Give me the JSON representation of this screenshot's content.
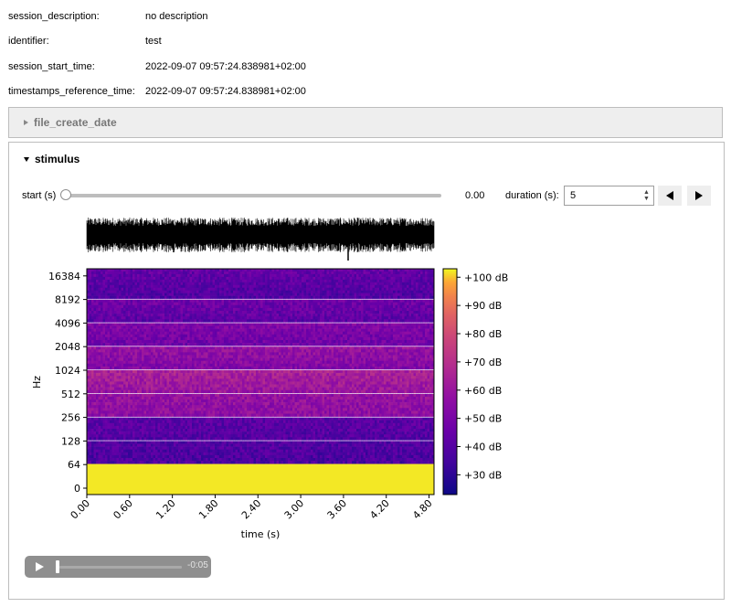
{
  "metadata": {
    "rows": [
      {
        "key": "session_description:",
        "value": "no description"
      },
      {
        "key": "identifier:",
        "value": "test"
      },
      {
        "key": "session_start_time:",
        "value": "2022-09-07 09:57:24.838981+02:00"
      },
      {
        "key": "timestamps_reference_time:",
        "value": "2022-09-07 09:57:24.838981+02:00"
      }
    ]
  },
  "accordions": {
    "file_create_date": {
      "title": "file_create_date",
      "expanded": false
    },
    "stimulus": {
      "title": "stimulus",
      "expanded": true
    }
  },
  "controls": {
    "start_label": "start (s)",
    "start_value": 0.0,
    "start_value_text": "0.00",
    "duration_label": "duration (s):",
    "duration_value": "5",
    "prev_icon": "triangle-left-icon",
    "next_icon": "triangle-right-icon"
  },
  "audio_player": {
    "time_text": "-0:05",
    "progress": 0.0,
    "play_icon": "play-icon"
  },
  "chart_data": {
    "type": "heatmap",
    "xlabel": "time (s)",
    "ylabel": "Hz",
    "x_ticks": [
      "0.00",
      "0.60",
      "1.20",
      "1.80",
      "2.40",
      "3.00",
      "3.60",
      "4.20",
      "4.80"
    ],
    "y_ticks": [
      "0",
      "64",
      "128",
      "256",
      "512",
      "1024",
      "2048",
      "4096",
      "8192",
      "16384"
    ],
    "xlim": [
      0,
      4.87
    ],
    "colorbar": {
      "ticks": [
        "+30 dB",
        "+40 dB",
        "+50 dB",
        "+60 dB",
        "+70 dB",
        "+80 dB",
        "+90 dB",
        "+100 dB"
      ],
      "range_db": [
        23,
        103
      ],
      "colormap": "plasma"
    },
    "waveform_above": true,
    "approx_band_levels_db": [
      {
        "band": "0-64 Hz",
        "db": 102
      },
      {
        "band": "64-128 Hz",
        "db": 38
      },
      {
        "band": "128-256 Hz",
        "db": 40
      },
      {
        "band": "256-512 Hz",
        "db": 57
      },
      {
        "band": "512-1024 Hz",
        "db": 62
      },
      {
        "band": "1024-2048 Hz",
        "db": 55
      },
      {
        "band": "2048-4096 Hz",
        "db": 49
      },
      {
        "band": "4096-8192 Hz",
        "db": 44
      },
      {
        "band": "8192-16384 Hz",
        "db": 41
      }
    ]
  }
}
